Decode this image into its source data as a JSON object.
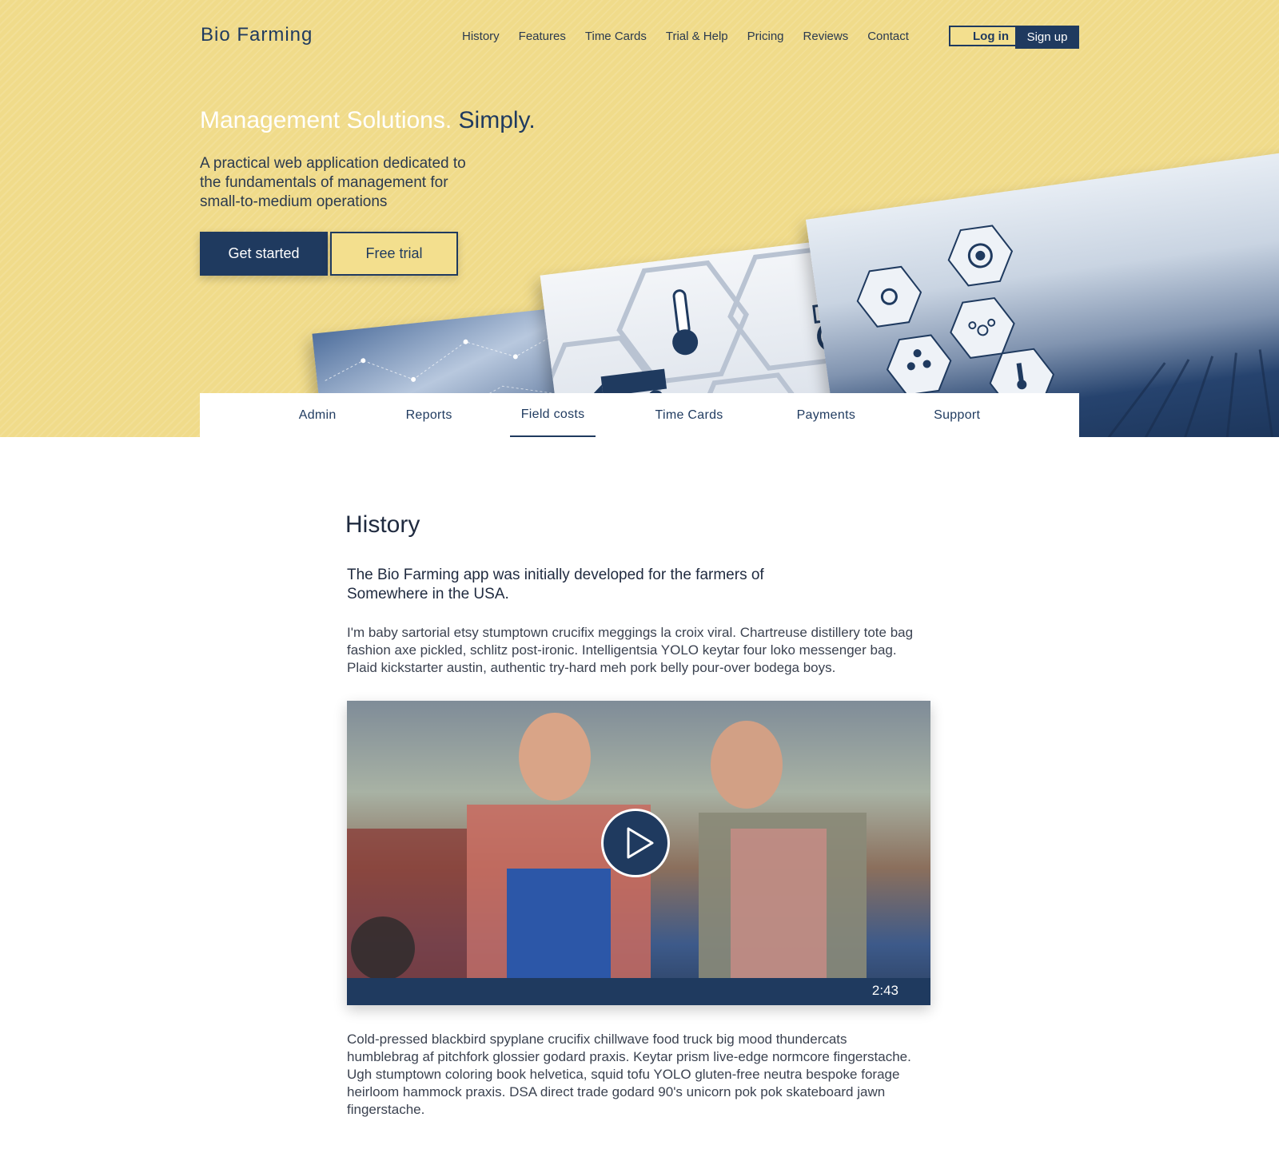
{
  "header": {
    "brand": "Bio Farming",
    "nav": [
      "History",
      "Features",
      "Time Cards",
      "Trial & Help",
      "Pricing",
      "Reviews",
      "Contact"
    ],
    "login_label": "Log in",
    "signup_label": "Sign up"
  },
  "hero": {
    "headline_light": "Management Solutions.",
    "headline_dark": "Simply.",
    "subtext": "A practical web application dedicated to the fundamentals of management for small-to-medium operations",
    "get_started_label": "Get started",
    "free_trial_label": "Free trial"
  },
  "tabs": [
    "Admin",
    "Reports",
    "Field costs",
    "Time Cards",
    "Payments",
    "Support"
  ],
  "active_tab": "Field costs",
  "history": {
    "title": "History",
    "lead": "The Bio Farming app was initially developed for the farmers of Somewhere in the USA.",
    "paragraph1": "I'm baby sartorial etsy stumptown crucifix meggings la croix viral. Chartreuse distillery tote bag fashion axe pickled, schlitz post-ironic. Intelligentsia YOLO keytar four loko messenger bag. Plaid kickstarter austin, authentic try-hard meh pork belly pour-over bodega boys.",
    "video_duration": "2:43",
    "paragraph2": "Cold-pressed blackbird spyplane crucifix chillwave food truck big mood thundercats humblebrag af pitchfork glossier godard praxis. Keytar prism live-edge normcore fingerstache. Ugh stumptown coloring book helvetica, squid tofu YOLO gluten-free neutra bespoke forage heirloom hammock praxis. DSA direct trade godard 90's unicorn pok pok skateboard jawn fingerstache."
  },
  "icons": [
    "play-icon",
    "thermometer-icon",
    "harvester-icon",
    "tractor-icon",
    "gear-icon",
    "sun-icon",
    "water-drop-icon",
    "bug-icon"
  ],
  "colors": {
    "hero_bg": "#f0db8a",
    "navy": "#1f3a5f",
    "white": "#ffffff"
  }
}
